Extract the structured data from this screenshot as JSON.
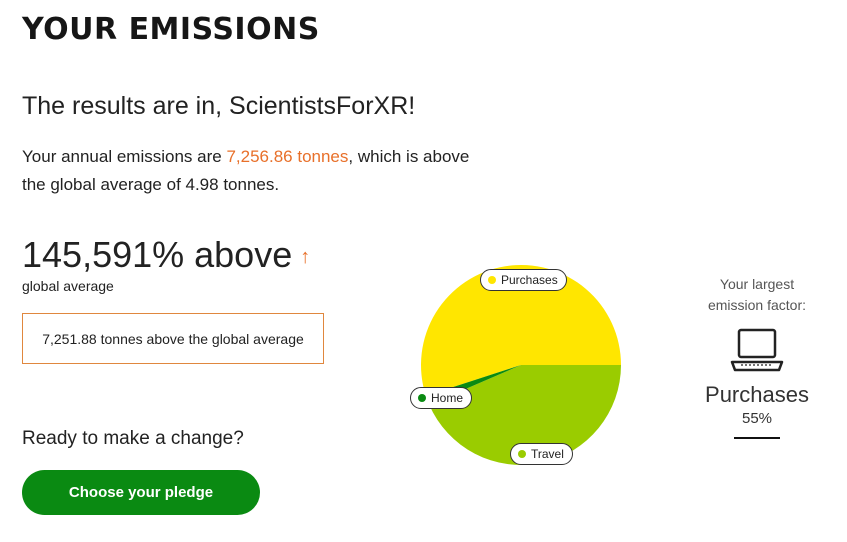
{
  "header": {
    "title": "YOUR EMISSIONS"
  },
  "results": {
    "greeting": "The results are in, ScientistsForXR!",
    "summary_prefix": "Your annual emissions are ",
    "emissions_value": "7,256.86 tonnes",
    "summary_suffix": ", which is above the global average of 4.98 tonnes."
  },
  "comparison": {
    "percent_text": "145,591% above",
    "arrow": "↑",
    "sub_label": "global average",
    "tonnes_above": "7,251.88 tonnes above the global average"
  },
  "cta": {
    "prompt": "Ready to make a change?",
    "button_label": "Choose your pledge"
  },
  "colors": {
    "accent": "#e8702a",
    "button": "#0a8a12"
  },
  "chart_data": {
    "type": "pie",
    "slices": [
      {
        "label": "Purchases",
        "value": 55,
        "color": "#ffe600"
      },
      {
        "label": "Travel",
        "value": 43.5,
        "color": "#9acc00"
      },
      {
        "label": "Home",
        "value": 1.5,
        "color": "#0a8a12"
      }
    ]
  },
  "largest_factor": {
    "title": "Your largest emission factor:",
    "icon": "laptop-icon",
    "name": "Purchases",
    "percent": "55%"
  }
}
